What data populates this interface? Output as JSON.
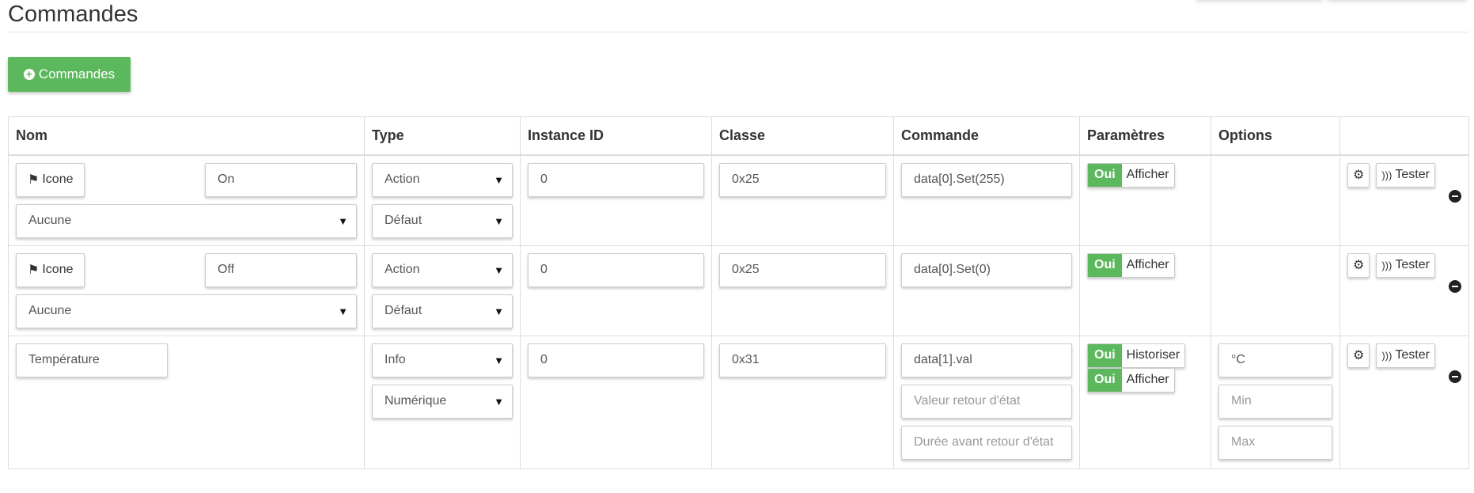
{
  "page": {
    "title": "Commandes",
    "add_button": "Commandes"
  },
  "headers": [
    "Nom",
    "Type",
    "Instance ID",
    "Classe",
    "Commande",
    "Paramètres",
    "Options",
    ""
  ],
  "icon_label": "Icone",
  "tester_label": "Tester",
  "rows": [
    {
      "name": "On",
      "has_icon": true,
      "parent": "Aucune",
      "type": "Action",
      "subtype": "Défaut",
      "instance": "0",
      "classe": "0x25",
      "commande": "data[0].Set(255)",
      "toggles": [
        {
          "state": "Oui",
          "label": "Afficher"
        }
      ]
    },
    {
      "name": "Off",
      "has_icon": true,
      "parent": "Aucune",
      "type": "Action",
      "subtype": "Défaut",
      "instance": "0",
      "classe": "0x25",
      "commande": "data[0].Set(0)",
      "toggles": [
        {
          "state": "Oui",
          "label": "Afficher"
        }
      ]
    },
    {
      "name": "Température",
      "has_icon": false,
      "type": "Info",
      "subtype": "Numérique",
      "instance": "0",
      "classe": "0x31",
      "commande": "data[1].val",
      "return_value_placeholder": "Valeur retour d'état",
      "return_delay_placeholder": "Durée avant retour d'état",
      "toggles": [
        {
          "state": "Oui",
          "label": "Historiser"
        },
        {
          "state": "Oui",
          "label": "Afficher"
        }
      ],
      "unit": "°C",
      "min_placeholder": "Min",
      "max_placeholder": "Max"
    }
  ],
  "colors": {
    "accent": "#5cb85c"
  }
}
